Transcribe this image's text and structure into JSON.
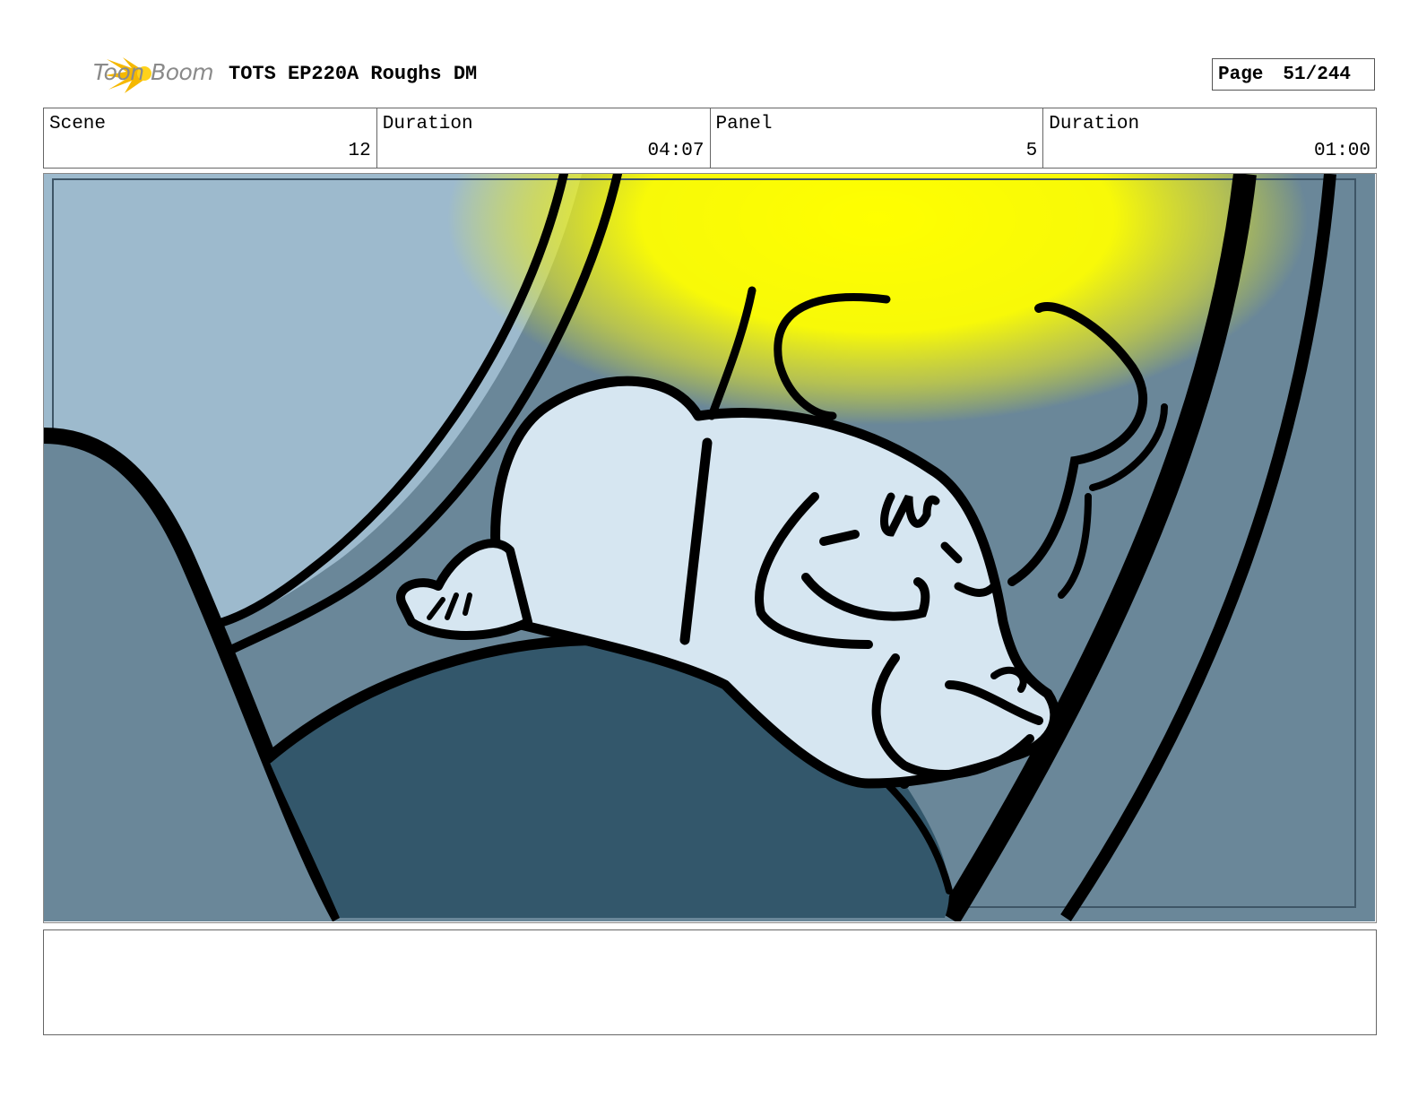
{
  "header": {
    "logo_text": "Toon Boom",
    "title": "TOTS EP220A Roughs DM",
    "page_label": "Page",
    "page_value": "51/244"
  },
  "info": [
    {
      "label": "Scene",
      "value": "12"
    },
    {
      "label": "Duration",
      "value": "04:07"
    },
    {
      "label": "Panel",
      "value": "5"
    },
    {
      "label": "Duration",
      "value": "01:00"
    }
  ],
  "panel": {
    "colors": {
      "sky_light": "#9dbacd",
      "wall": "#6a8799",
      "seat_dark": "#33576b",
      "character": "#d6e6f1",
      "light": "#ffff00",
      "ink": "#000000"
    }
  },
  "notes": {
    "text": ""
  }
}
